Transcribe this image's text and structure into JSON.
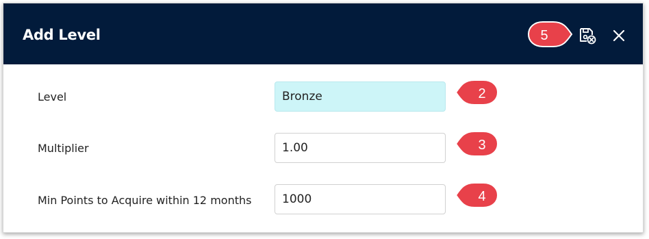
{
  "dialog": {
    "title": "Add Level",
    "save_close_icon": "save-close-icon",
    "close_icon": "close-icon"
  },
  "form": {
    "rows": [
      {
        "label": "Level",
        "value": "Bronze"
      },
      {
        "label": "Multiplier",
        "value": "1.00"
      },
      {
        "label": "Min Points to Acquire within 12 months",
        "value": "1000"
      }
    ]
  },
  "callouts": [
    "5",
    "2",
    "3",
    "4"
  ],
  "colors": {
    "header_bg": "#021b3b",
    "callout_red": "#e8414a",
    "active_field_bg": "#cdf5f8"
  }
}
